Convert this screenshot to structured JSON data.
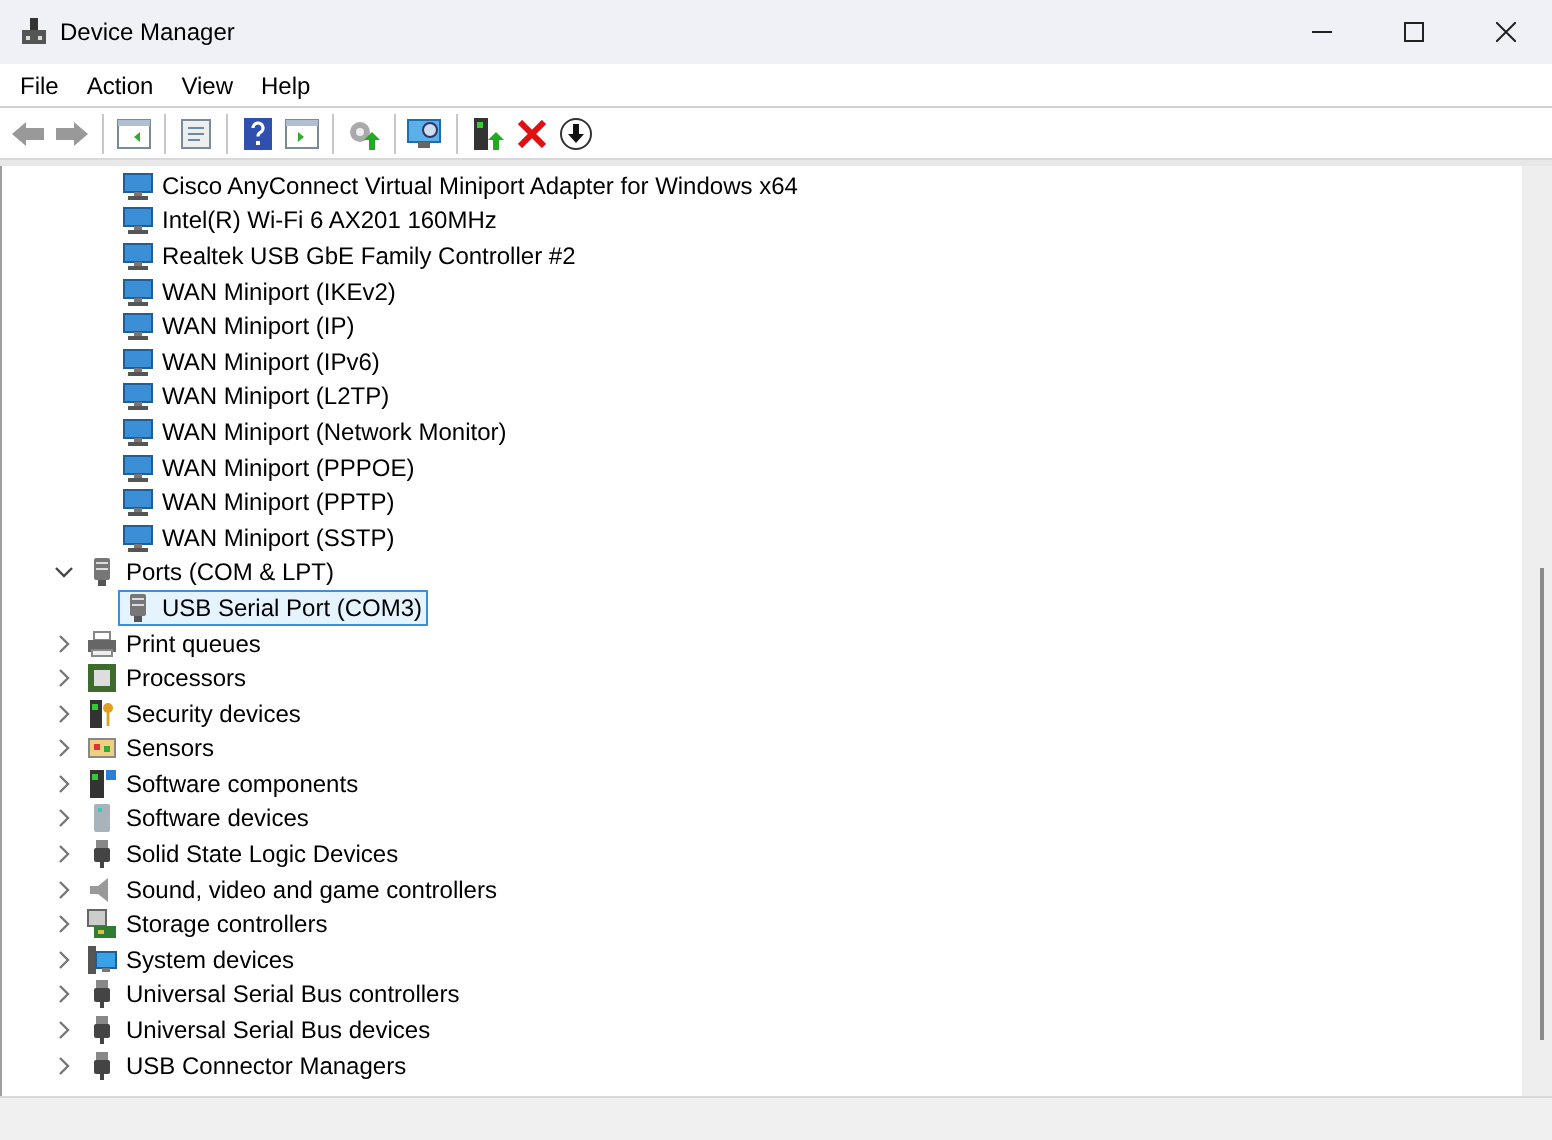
{
  "window": {
    "title": "Device Manager"
  },
  "menu": [
    "File",
    "Action",
    "View",
    "Help"
  ],
  "tree": {
    "partial_group": [
      {
        "label": "Cisco AnyConnect Virtual Miniport Adapter for Windows x64",
        "kind": "network",
        "selected": false
      },
      {
        "label": "Intel(R) Wi-Fi 6 AX201 160MHz",
        "kind": "network",
        "selected": false
      },
      {
        "label": "Realtek USB GbE Family Controller #2",
        "kind": "network",
        "selected": false
      },
      {
        "label": "WAN Miniport (IKEv2)",
        "kind": "network",
        "selected": false
      },
      {
        "label": "WAN Miniport (IP)",
        "kind": "network",
        "selected": false
      },
      {
        "label": "WAN Miniport (IPv6)",
        "kind": "network",
        "selected": false
      },
      {
        "label": "WAN Miniport (L2TP)",
        "kind": "network",
        "selected": false
      },
      {
        "label": "WAN Miniport (Network Monitor)",
        "kind": "network",
        "selected": false
      },
      {
        "label": "WAN Miniport (PPPOE)",
        "kind": "network",
        "selected": false
      },
      {
        "label": "WAN Miniport (PPTP)",
        "kind": "network",
        "selected": false
      },
      {
        "label": "WAN Miniport (SSTP)",
        "kind": "network",
        "selected": false
      }
    ],
    "categories": [
      {
        "label": "Ports (COM & LPT)",
        "kind": "port",
        "expanded": true,
        "selected": false,
        "children": [
          {
            "label": "USB Serial Port (COM3)",
            "kind": "port",
            "selected": true
          }
        ]
      },
      {
        "label": "Print queues",
        "kind": "printer",
        "expanded": false,
        "selected": false
      },
      {
        "label": "Processors",
        "kind": "processor",
        "expanded": false,
        "selected": false
      },
      {
        "label": "Security devices",
        "kind": "security",
        "expanded": false,
        "selected": false
      },
      {
        "label": "Sensors",
        "kind": "sensor",
        "expanded": false,
        "selected": false
      },
      {
        "label": "Software components",
        "kind": "component",
        "expanded": false,
        "selected": false
      },
      {
        "label": "Software devices",
        "kind": "software",
        "expanded": false,
        "selected": false
      },
      {
        "label": "Solid State Logic Devices",
        "kind": "usb",
        "expanded": false,
        "selected": false
      },
      {
        "label": "Sound, video and game controllers",
        "kind": "sound",
        "expanded": false,
        "selected": false
      },
      {
        "label": "Storage controllers",
        "kind": "storage",
        "expanded": false,
        "selected": false
      },
      {
        "label": "System devices",
        "kind": "system",
        "expanded": false,
        "selected": false
      },
      {
        "label": "Universal Serial Bus controllers",
        "kind": "usb",
        "expanded": false,
        "selected": false
      },
      {
        "label": "Universal Serial Bus devices",
        "kind": "usb",
        "expanded": false,
        "selected": false
      },
      {
        "label": "USB Connector Managers",
        "kind": "usb",
        "expanded": false,
        "selected": false
      }
    ]
  }
}
